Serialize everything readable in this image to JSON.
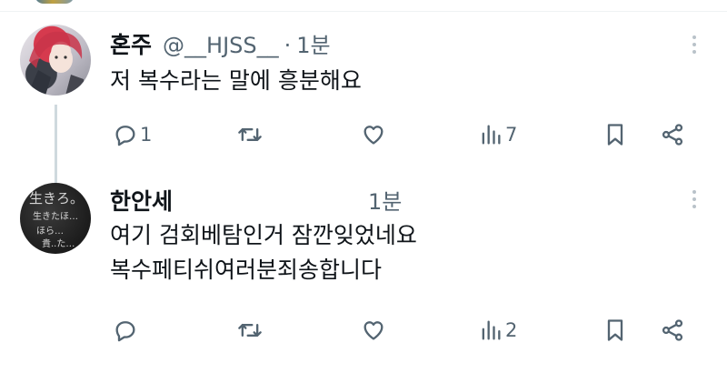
{
  "tweets": [
    {
      "display_name": "혼주",
      "handle": "@__HJSS__",
      "separator": "·",
      "time": "1분",
      "lines": [
        "저 복수라는 말에 흥분해요"
      ],
      "replies": "1",
      "retweets": "",
      "likes": "",
      "views": "7"
    },
    {
      "display_name": "한안세",
      "handle": "",
      "separator": "",
      "time": "1분",
      "lines": [
        "여기 검회베탐인거 잠깐잊었네요",
        "복수페티쉬여러분죄송합니다"
      ],
      "replies": "",
      "retweets": "",
      "likes": "",
      "views": "2",
      "avatar_text": [
        "生きろ。",
        "生きたほ…",
        "ほら…",
        "貴..た…"
      ]
    }
  ],
  "icons": {
    "reply": "reply-icon",
    "retweet": "retweet-icon",
    "like": "heart-icon",
    "views": "views-icon",
    "bookmark": "bookmark-icon",
    "share": "share-icon",
    "more": "more-icon"
  },
  "colors": {
    "text": "#0f1419",
    "secondary": "#536471",
    "thread_line": "#cfd9de",
    "divider": "#eff3f4"
  }
}
